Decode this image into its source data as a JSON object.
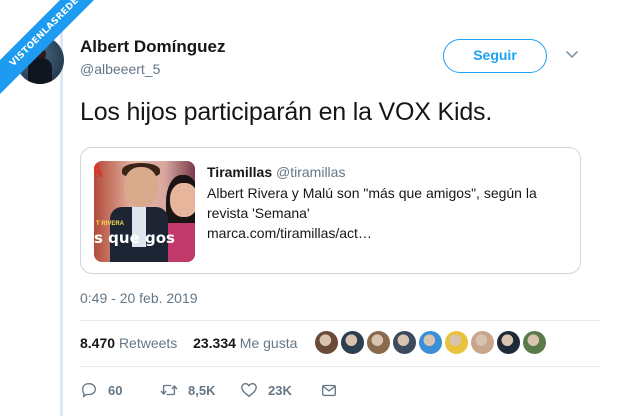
{
  "watermark": "VISTOENLASREDES",
  "author": {
    "name": "Albert Domínguez",
    "handle": "@albeeert_5",
    "avatar_icon": "avatar-photo"
  },
  "follow_button": "Seguir",
  "tweet": {
    "text": "Los hijos participarán en la VOX Kids."
  },
  "quote": {
    "name": "Tiramillas",
    "handle": "@tiramillas",
    "line1": "Albert Rivera y Malú son \"más que amigos\", según la",
    "line2": "revista 'Semana'",
    "link": "marca.com/tiramillas/act…",
    "image_text": "s que gos",
    "image_tag": "T RIVERA"
  },
  "timestamp": "0:49 - 20 feb. 2019",
  "stats": {
    "retweets_count": "8.470",
    "retweets_label": "Retweets",
    "likes_count": "23.334",
    "likes_label": "Me gusta"
  },
  "liker_avatars": [
    "#6b4a3a",
    "#2c3e50",
    "#8a6a4c",
    "#3b4a5c",
    "#3a8fd6",
    "#e8c23a",
    "#c9a58a",
    "#1d2a3a",
    "#5a7a4a"
  ],
  "actions": {
    "reply_count": "60",
    "retweet_count": "8,5K",
    "like_count": "23K"
  },
  "colors": {
    "accent": "#1da1f2",
    "secondary_text": "#657786"
  }
}
